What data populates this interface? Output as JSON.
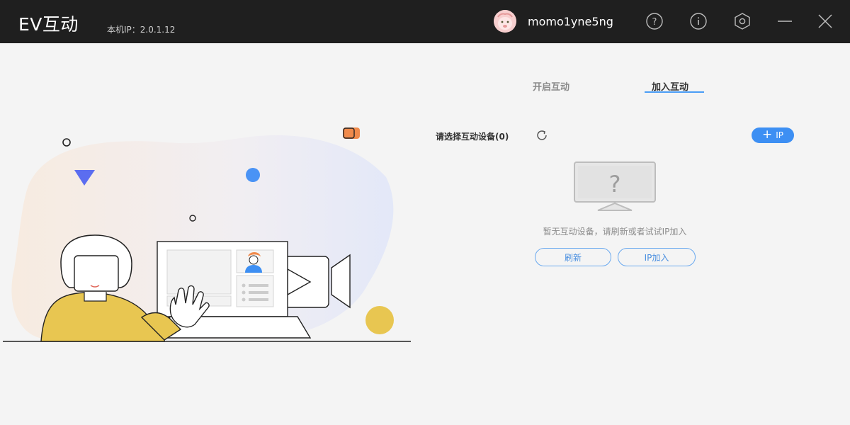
{
  "titlebar": {
    "app_title": "EV互动",
    "local_ip": "本机IP：2.0.1.12",
    "username": "momo1yne5ng",
    "icons": [
      "help-icon",
      "info-icon",
      "settings-icon",
      "minimize-icon",
      "close-icon"
    ]
  },
  "tabs": [
    {
      "label": "开启互动",
      "active": false
    },
    {
      "label": "加入互动",
      "active": true
    }
  ],
  "devices": {
    "label": "请选择互动设备(0)",
    "add_ip_label": "IP",
    "empty_text": "暂无互动设备，请刷新或者试试IP加入",
    "refresh_button": "刷新",
    "ip_join_button": "IP加入"
  },
  "colors": {
    "accent": "#3d8ff3",
    "titlebar": "#1f1f1f",
    "background": "#f4f4f4"
  }
}
